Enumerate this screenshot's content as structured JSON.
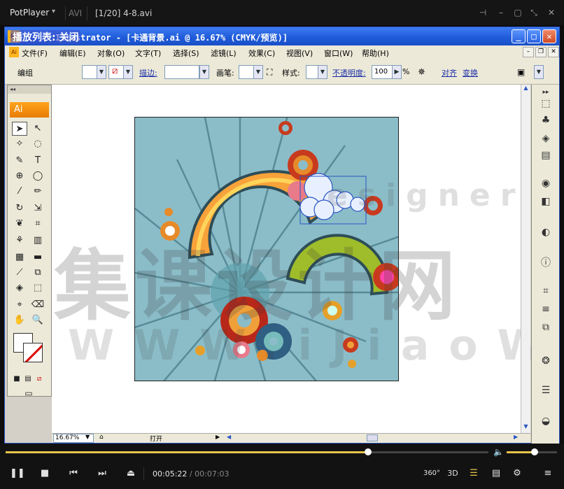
{
  "player": {
    "brand": "PotPlayer",
    "format": "AVI",
    "title": "[1/20] 4-8.avi",
    "current_time": "00:05:22",
    "separator": "/",
    "total_time": "00:07:03",
    "progress_fraction": 0.75,
    "volume_fraction": 0.56,
    "label_360": "360°",
    "label_3d": "3D"
  },
  "illustrator": {
    "logo": "Ai",
    "overlay_text": "播放列表: 关闭",
    "window_title": "Illustrator - [卡通背景.ai @ 16.67% (CMYK/预览)]",
    "menu": [
      "文件(F)",
      "编辑(E)",
      "对象(O)",
      "文字(T)",
      "选择(S)",
      "滤镜(L)",
      "效果(C)",
      "视图(V)",
      "窗口(W)",
      "帮助(H)"
    ],
    "control": {
      "mode": "编组",
      "stroke_label": "描边:",
      "brush_label": "画笔:",
      "style_label": "样式:",
      "opacity_label": "不透明度:",
      "opacity_value": "100",
      "percent": "%",
      "align_label": "对齐",
      "transform_label": "变换"
    },
    "status": {
      "zoom": "16.67%",
      "state": "打开"
    },
    "watermark": {
      "main": "集课设计网",
      "url": "WWW.iJiaoWu.COM",
      "side": "esigner"
    }
  }
}
